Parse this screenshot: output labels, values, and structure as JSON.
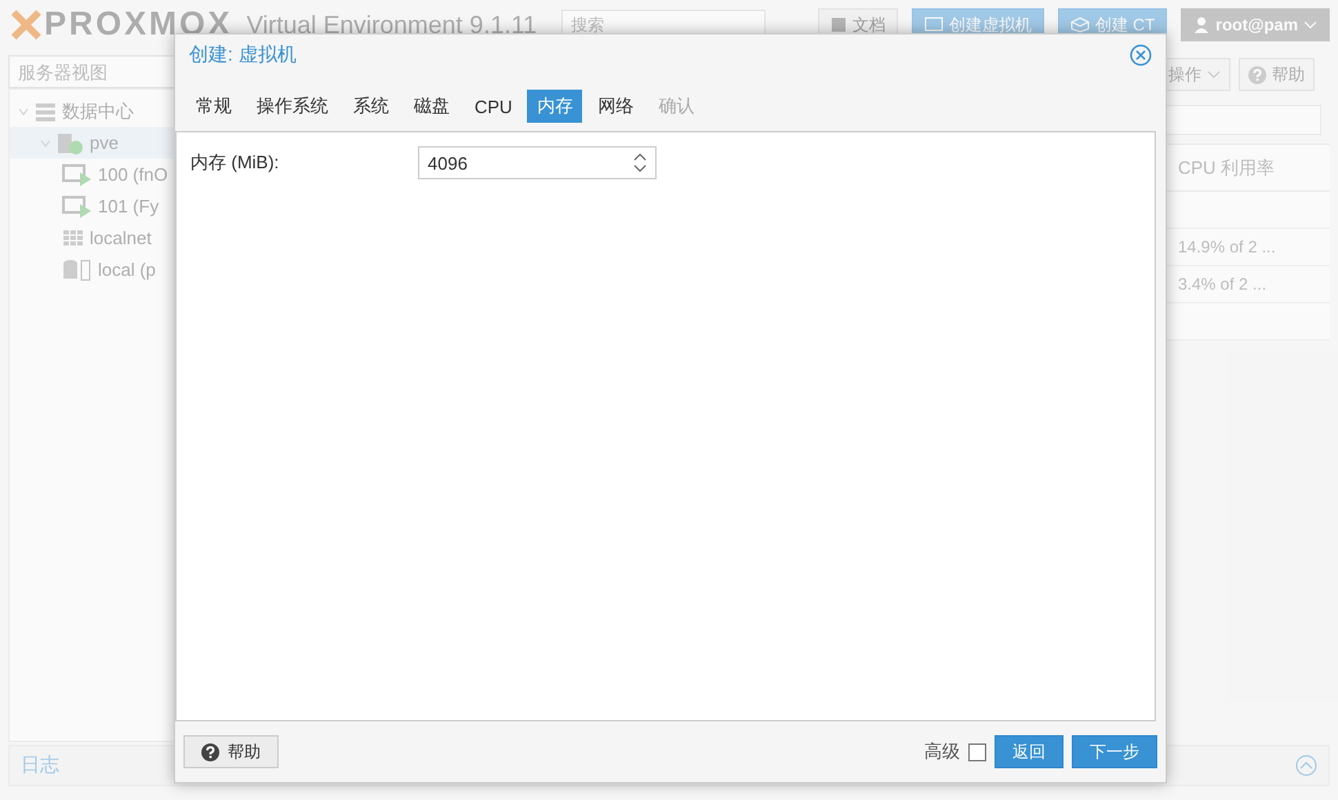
{
  "header": {
    "logo": "PROXMOX",
    "product": "Virtual Environment 9.1.11",
    "search": {
      "placeholder": "搜索"
    },
    "buttons": [
      {
        "kind": "docs",
        "label": "文档"
      },
      {
        "kind": "vm",
        "label": "创建虚拟机"
      },
      {
        "kind": "ct",
        "label": "创建 CT"
      }
    ],
    "user": "root@pam"
  },
  "sidebar": {
    "view": "服务器视图",
    "tree": [
      {
        "label": "数据中心",
        "kind": "datacenter",
        "expanded": true,
        "selected": false,
        "children": [
          {
            "label": "pve",
            "kind": "node",
            "expanded": true,
            "selected": true,
            "children": [
              {
                "label": "100 (fnO",
                "kind": "vm",
                "selected": false
              },
              {
                "label": "101 (Fy",
                "kind": "vm",
                "selected": false
              },
              {
                "label": "localnet",
                "kind": "network",
                "selected": false
              },
              {
                "label": "local (p",
                "kind": "storage",
                "selected": false
              }
            ]
          }
        ]
      }
    ]
  },
  "content": {
    "buttons": [
      {
        "kind": "menu",
        "label": "操作"
      },
      {
        "kind": "help",
        "label": "帮助"
      }
    ],
    "table": {
      "columns": [
        "CPU 利用率"
      ],
      "rows": [
        [
          ""
        ],
        [
          "14.9% of 2 ..."
        ],
        [
          "3.4% of 2 ..."
        ],
        [
          ""
        ]
      ]
    }
  },
  "log_panel": {
    "title": "日志",
    "expanded": false
  },
  "dialog": {
    "title": "创建: 虚拟机",
    "tabs": [
      {
        "label": "常规",
        "selected": false,
        "disabled": false
      },
      {
        "label": "操作系统",
        "selected": false,
        "disabled": false
      },
      {
        "label": "系统",
        "selected": false,
        "disabled": false
      },
      {
        "label": "磁盘",
        "selected": false,
        "disabled": false
      },
      {
        "label": "CPU",
        "selected": false,
        "disabled": false
      },
      {
        "label": "内存",
        "selected": true,
        "disabled": false
      },
      {
        "label": "网络",
        "selected": false,
        "disabled": false
      },
      {
        "label": "确认",
        "selected": false,
        "disabled": true
      }
    ],
    "fields": [
      {
        "label": "内存 (MiB):",
        "value": "4096"
      }
    ],
    "help": "帮助",
    "advanced": {
      "label": "高级",
      "checked": false
    },
    "back": "返回",
    "next": "下一步"
  }
}
